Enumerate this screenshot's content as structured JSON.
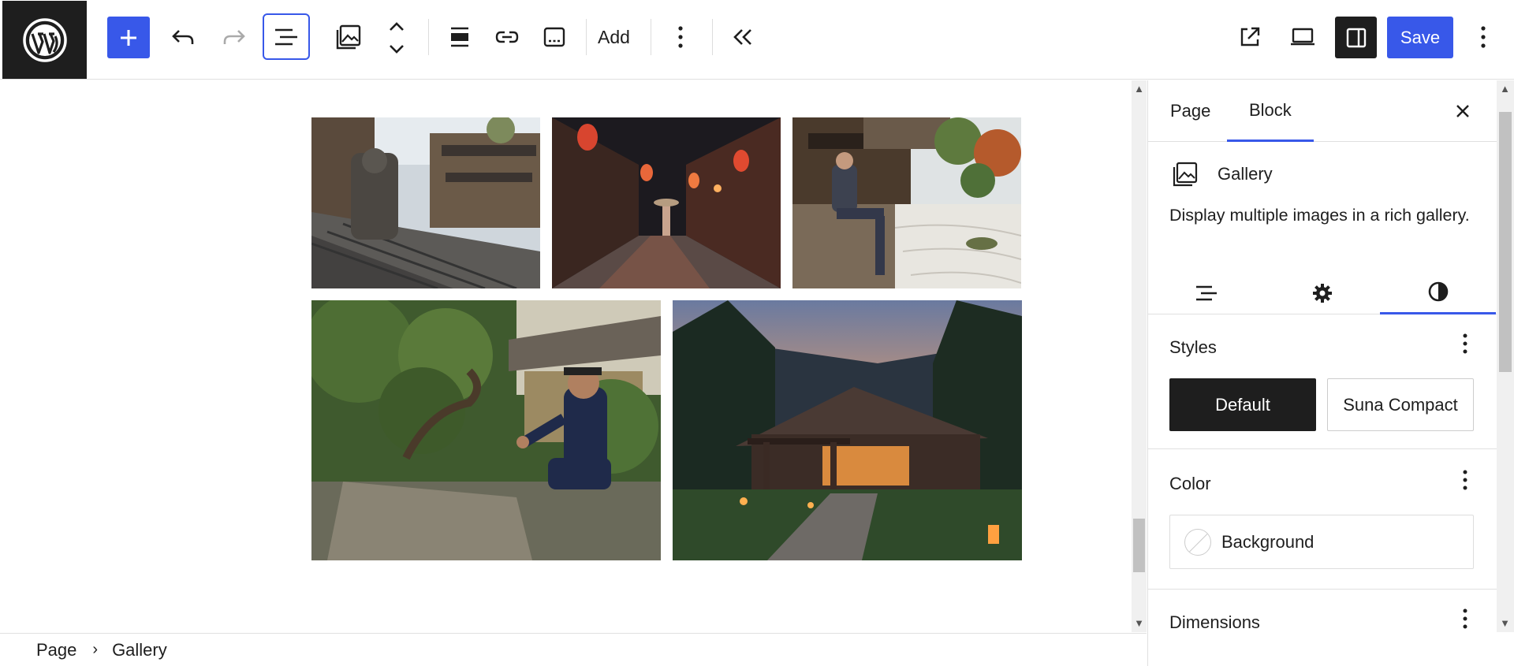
{
  "toolbar": {
    "add_label": "Add",
    "save_label": "Save"
  },
  "breadcrumb": {
    "items": [
      "Page",
      "Gallery"
    ]
  },
  "sidebar": {
    "tabs": [
      {
        "label": "Page",
        "active": false
      },
      {
        "label": "Block",
        "active": true
      }
    ],
    "block": {
      "name": "Gallery",
      "description": "Display multiple images in a rich gallery."
    },
    "sub_tabs": [
      "list-view-icon",
      "gear-icon",
      "contrast-icon"
    ],
    "active_sub_tab": "contrast-icon",
    "styles": {
      "title": "Styles",
      "options": [
        "Default",
        "Suna Compact"
      ],
      "selected": "Default"
    },
    "color": {
      "title": "Color",
      "items": [
        "Background"
      ]
    },
    "dimensions": {
      "title": "Dimensions"
    }
  },
  "colors": {
    "accent": "#3858e9",
    "dark": "#1e1e1e"
  }
}
